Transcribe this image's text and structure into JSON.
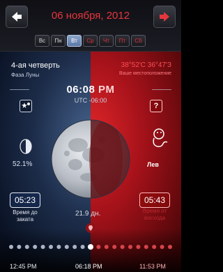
{
  "header": {
    "date": "06 ноября, 2012"
  },
  "days": [
    {
      "label": "Вс",
      "kind": "normal"
    },
    {
      "label": "Пн",
      "kind": "normal"
    },
    {
      "label": "Вт",
      "kind": "active"
    },
    {
      "label": "Ср",
      "kind": "normal"
    },
    {
      "label": "Чт",
      "kind": "we"
    },
    {
      "label": "Пт",
      "kind": "we"
    },
    {
      "label": "Сб",
      "kind": "we"
    }
  ],
  "phase": {
    "title": "4-ая четверть",
    "subtitle": "Фаза Луны"
  },
  "location": {
    "coords": "38°52'C 36°47'З",
    "caption": "Ваше местоположение"
  },
  "time": {
    "main_left": "06:08",
    "main_right": "PM",
    "utc": "UTC -06:00"
  },
  "illumination": "52.1%",
  "zodiac": {
    "label": "Лев"
  },
  "moonset": {
    "time": "05:23",
    "caption_line1": "Время до",
    "caption_line2": "заката"
  },
  "moonrise": {
    "time": "05:43",
    "caption_line1": "Время от",
    "caption_line2": "восхода"
  },
  "age": "21.9 дн.",
  "bottom_times": {
    "left": "12:45 PM",
    "center": "06:18 PM",
    "right": "11:53 PM"
  },
  "icons": {
    "back": "back-arrow-icon",
    "forward": "forward-arrow-icon",
    "star": "star-moon-icon",
    "help": "help-icon",
    "location": "location-icon",
    "zodiac": "leo-icon"
  },
  "colors": {
    "accent_red": "#e6363d",
    "night_blue": "#1c2c49",
    "day_red": "#a6121a"
  }
}
